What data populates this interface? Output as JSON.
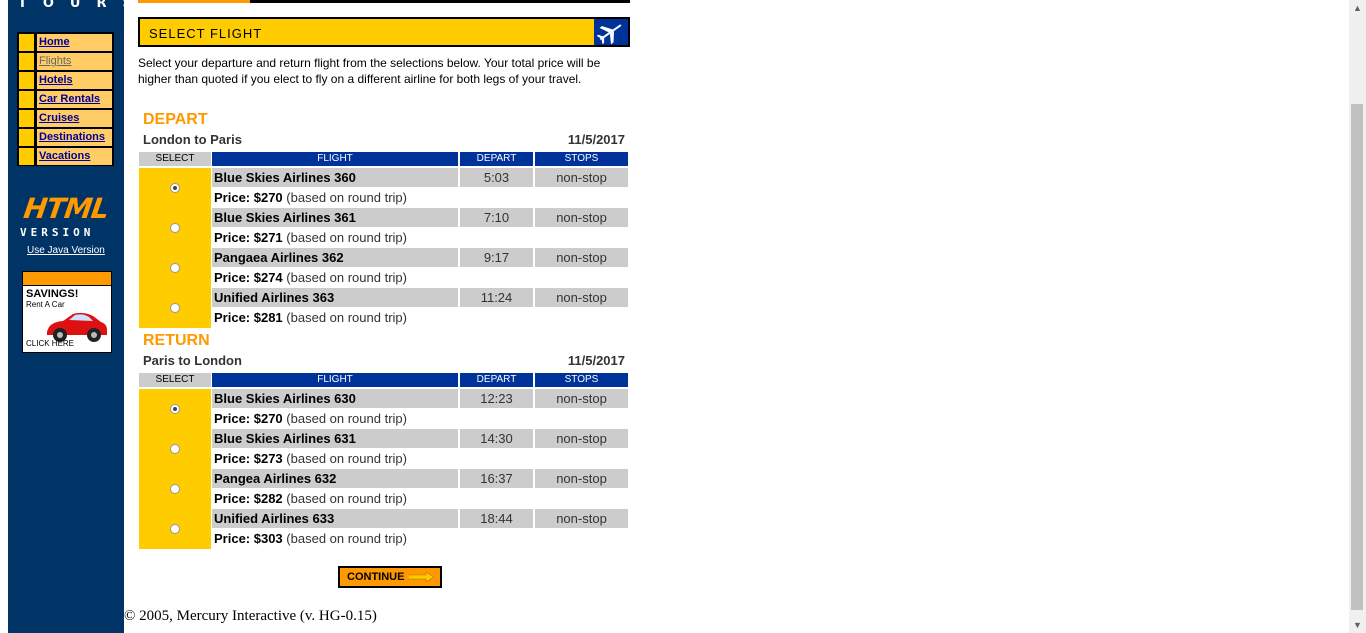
{
  "brand": {
    "text": "TOURS"
  },
  "nav": {
    "items": [
      {
        "label": "Home"
      },
      {
        "label": "Flights"
      },
      {
        "label": "Hotels"
      },
      {
        "label": "Car Rentals"
      },
      {
        "label": "Cruises"
      },
      {
        "label": "Destinations"
      },
      {
        "label": "Vacations"
      }
    ],
    "current": "Flights"
  },
  "logo": {
    "html": "HTML",
    "version": "VERSION",
    "java_link": "Use Java Version"
  },
  "ad": {
    "title": "SAVINGS!",
    "subtitle": "Rent A Car",
    "cta": "CLICK HERE"
  },
  "header": {
    "title": "SELECT FLIGHT"
  },
  "intro": "Select your departure and return flight from the selections below. Your total price will be higher than quoted if you elect to fly on a different airline for both legs of your travel.",
  "columns": {
    "select": "SELECT",
    "flight": "FLIGHT",
    "depart": "DEPART",
    "stops": "STOPS"
  },
  "price_suffix": "(based on round trip)",
  "depart": {
    "heading": "DEPART",
    "route": "London to Paris",
    "date": "11/5/2017",
    "flights": [
      {
        "name": "Blue Skies Airlines 360",
        "time": "5:03",
        "stops": "non-stop",
        "price_label": "Price: $270",
        "selected": true
      },
      {
        "name": "Blue Skies Airlines 361",
        "time": "7:10",
        "stops": "non-stop",
        "price_label": "Price: $271",
        "selected": false
      },
      {
        "name": "Pangaea Airlines 362",
        "time": "9:17",
        "stops": "non-stop",
        "price_label": "Price: $274",
        "selected": false
      },
      {
        "name": "Unified Airlines 363",
        "time": "11:24",
        "stops": "non-stop",
        "price_label": "Price: $281",
        "selected": false
      }
    ]
  },
  "return": {
    "heading": "RETURN",
    "route": "Paris to London",
    "date": "11/5/2017",
    "flights": [
      {
        "name": "Blue Skies Airlines 630",
        "time": "12:23",
        "stops": "non-stop",
        "price_label": "Price: $270",
        "selected": true
      },
      {
        "name": "Blue Skies Airlines 631",
        "time": "14:30",
        "stops": "non-stop",
        "price_label": "Price: $273",
        "selected": false
      },
      {
        "name": "Pangea Airlines 632",
        "time": "16:37",
        "stops": "non-stop",
        "price_label": "Price: $282",
        "selected": false
      },
      {
        "name": "Unified Airlines 633",
        "time": "18:44",
        "stops": "non-stop",
        "price_label": "Price: $303",
        "selected": false
      }
    ]
  },
  "continue_label": "CONTINUE",
  "footer": "© 2005, Mercury Interactive (v. HG-0.15)",
  "colors": {
    "navy": "#003366",
    "gold": "#ffcc00",
    "orange": "#ff9900",
    "header_blue": "#003399",
    "gray": "#cccccc"
  },
  "icons": [
    "airplane-icon",
    "arrow-right-icon",
    "car-icon",
    "scroll-up-icon",
    "scroll-down-icon"
  ]
}
